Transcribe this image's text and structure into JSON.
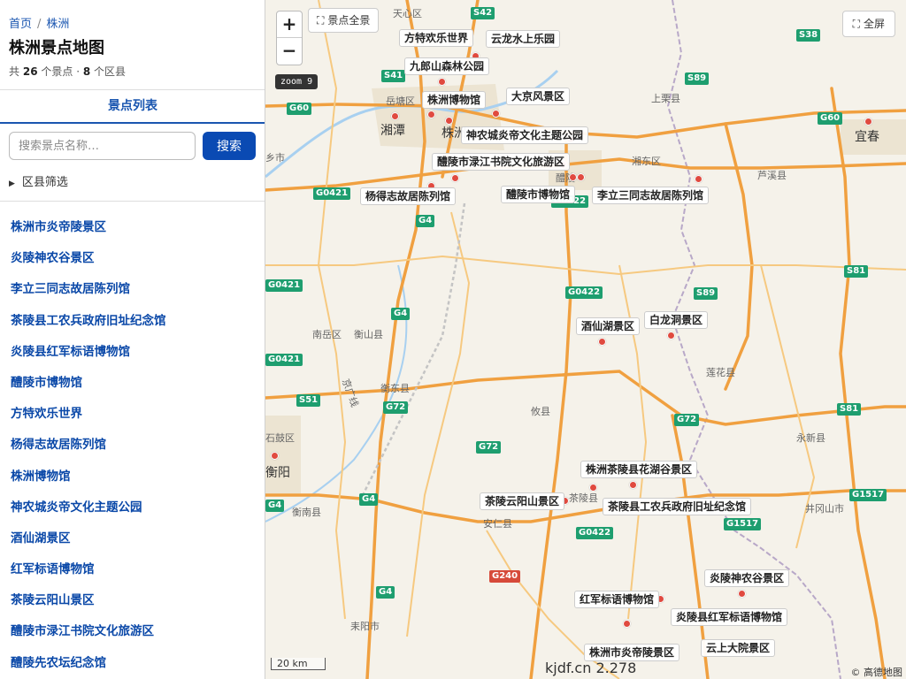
{
  "breadcrumb": {
    "home": "首页",
    "current": "株洲",
    "separator": "/"
  },
  "page_title": "株洲景点地图",
  "stats": {
    "prefix": "共",
    "spots": "26",
    "spots_unit": "个景点 ·",
    "districts": "8",
    "districts_unit": "个区县"
  },
  "tab_label": "景点列表",
  "search": {
    "placeholder": "搜索景点名称…",
    "button": "搜索"
  },
  "filter_label": "区县筛选",
  "list_items": [
    "株洲市炎帝陵景区",
    "炎陵神农谷景区",
    "李立三同志故居陈列馆",
    "茶陵县工农兵政府旧址纪念馆",
    "炎陵县红军标语博物馆",
    "醴陵市博物馆",
    "方特欢乐世界",
    "杨得志故居陈列馆",
    "株洲博物馆",
    "神农城炎帝文化主题公园",
    "酒仙湖景区",
    "红军标语博物馆",
    "茶陵云阳山景区",
    "醴陵市渌江书院文化旅游区",
    "醴陵先农坛纪念馆"
  ],
  "map": {
    "zoom_in": "+",
    "zoom_out": "−",
    "zoom_label": "zoom 9",
    "overview_button": "景点全景",
    "fullscreen_button": "全屏",
    "scale_label": "20 km",
    "watermark": "kjdf.cn 2.278",
    "copyright": "© 高德地图",
    "poi_labels": [
      "方特欢乐世界",
      "云龙水上乐园",
      "九郎山森林公园",
      "株洲博物馆",
      "大京风景区",
      "神农城炎帝文化主题公园",
      "醴陵市渌江书院文化旅游区",
      "杨得志故居陈列馆",
      "醴陵市博物馆",
      "李立三同志故居陈列馆",
      "酒仙湖景区",
      "白龙洞景区",
      "株洲茶陵县花湖谷景区",
      "茶陵云阳山景区",
      "茶陵县工农兵政府旧址纪念馆",
      "炎陵神农谷景区",
      "红军标语博物馆",
      "炎陵县红军标语博物馆",
      "株洲市炎帝陵景区",
      "云上大院景区"
    ],
    "place_names": {
      "xiangtan": "湘潭",
      "zhuzhou": "株洲",
      "yichun": "宜春",
      "hengyang": "衡阳",
      "tianxin": "天心区",
      "yuetang": "岳塘区",
      "shangli": "上栗县",
      "luxi": "芦溪县",
      "xiangdong": "湘东区",
      "liling": "醴陵",
      "nanyue": "南岳区",
      "hengshan": "衡山县",
      "hengdong": "衡东县",
      "youxian": "攸县",
      "lianhua": "莲花县",
      "yongxin": "永新县",
      "shigu": "石鼓区",
      "hengnan": "衡南县",
      "anren": "安仁县",
      "chaling": "茶陵县",
      "jinggangshan": "井冈山市",
      "leiyang": "耒阳市",
      "jingguang": "京广线",
      "xiangxiang": "乡市"
    },
    "route_shields": {
      "s42": "S42",
      "s41": "S41",
      "g60": "G60",
      "s89": "S89",
      "s38": "S38",
      "g60b": "G60",
      "g0421": "G0421",
      "g4": "G4",
      "g0422": "G0422",
      "s81": "S81",
      "s51": "S51",
      "g72": "G72",
      "g0421b": "G0421",
      "g4b": "G4",
      "g72b": "G72",
      "g72c": "G72",
      "s81b": "S81",
      "g1517": "G1517",
      "g4c": "G4",
      "g0422b": "G0422",
      "g240": "G240",
      "g4d": "G4",
      "g1517b": "G1517",
      "g0422c": "G0422",
      "s89b": "S89",
      "g4e": "G4",
      "g0421c": "G0421"
    }
  }
}
